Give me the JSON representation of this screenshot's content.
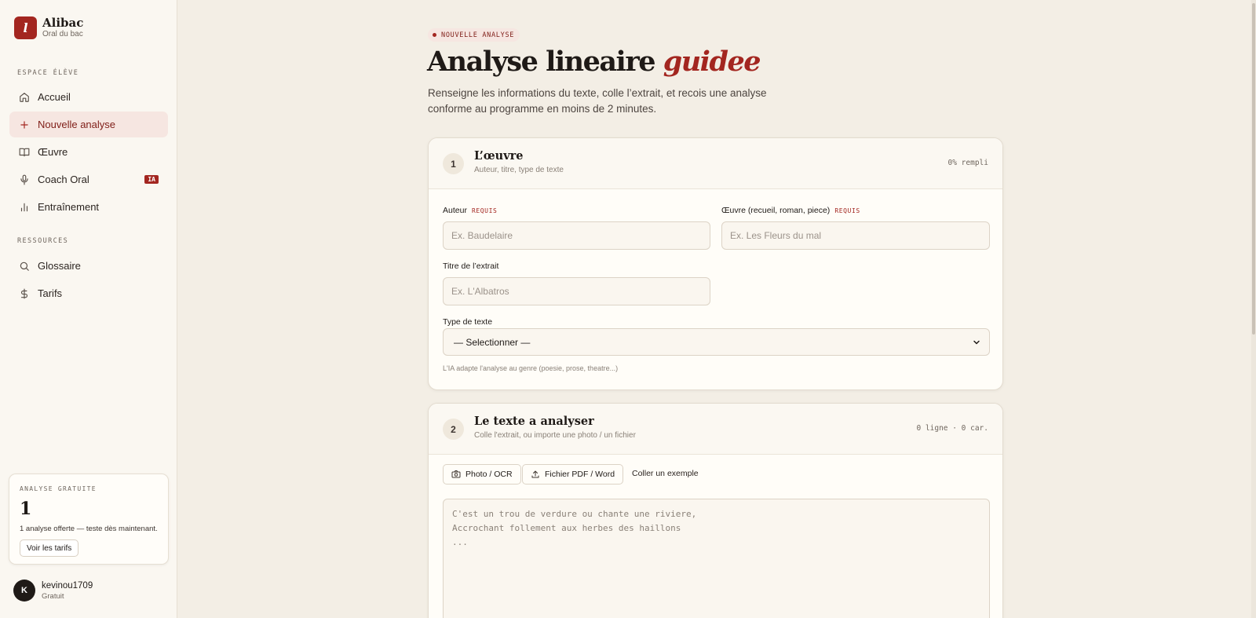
{
  "brand": {
    "logo_letter": "l",
    "name": "Alibac",
    "subtitle": "Oral du bac"
  },
  "sidebar": {
    "section_student": "ESPACE ÉLÈVE",
    "items": [
      {
        "label": "Accueil",
        "icon": "home-icon"
      },
      {
        "label": "Nouvelle analyse",
        "icon": "plus-icon",
        "active": true
      },
      {
        "label": "Œuvre",
        "icon": "book-icon"
      },
      {
        "label": "Coach Oral",
        "icon": "microphone-icon",
        "badge": "IA"
      },
      {
        "label": "Entraînement",
        "icon": "bar-chart-icon"
      }
    ],
    "section_resources": "RESSOURCES",
    "resources": [
      {
        "label": "Glossaire",
        "icon": "search-icon"
      },
      {
        "label": "Tarifs",
        "icon": "dollar-icon"
      }
    ],
    "promo": {
      "label": "ANALYSE GRATUITE",
      "count": "1",
      "text": "1 analyse offerte — teste dès maintenant.",
      "button": "Voir les tarifs"
    },
    "user": {
      "initial": "K",
      "name": "kevinou1709",
      "plan": "Gratuit"
    }
  },
  "main": {
    "eyebrow": "NOUVELLE ANALYSE",
    "title_plain": "Analyse lineaire ",
    "title_accent": "guidee",
    "subtitle": "Renseigne les informations du texte, colle l’extrait, et recois une analyse conforme au programme en moins de 2 minutes."
  },
  "card1": {
    "step": "1",
    "title": "L’œuvre",
    "subtitle": "Auteur, titre, type de texte",
    "progress": "0% rempli",
    "author_label": "Auteur",
    "author_required": "REQUIS",
    "author_placeholder": "Ex. Baudelaire",
    "work_label": "Œuvre (recueil, roman, piece)",
    "work_required": "REQUIS",
    "work_placeholder": "Ex. Les Fleurs du mal",
    "extract_label": "Titre de l’extrait",
    "extract_placeholder": "Ex. L'Albatros",
    "type_label": "Type de texte",
    "type_value": "— Selectionner —",
    "hint": "L'IA adapte l'analyse au genre (poesie, prose, theatre...)"
  },
  "card2": {
    "step": "2",
    "title": "Le texte a analyser",
    "subtitle": "Colle l'extrait, ou importe une photo / un fichier",
    "counter": "0 ligne · 0 car.",
    "photo_button": "Photo / OCR",
    "file_button": "Fichier PDF / Word",
    "example_link": "Coller un exemple",
    "placeholder": "C'est un trou de verdure ou chante une riviere,\nAccrochant follement aux herbes des haillons\n..."
  },
  "colors": {
    "accent": "#a32620",
    "background": "#f3eee5",
    "sidebar": "#faf7f1"
  }
}
